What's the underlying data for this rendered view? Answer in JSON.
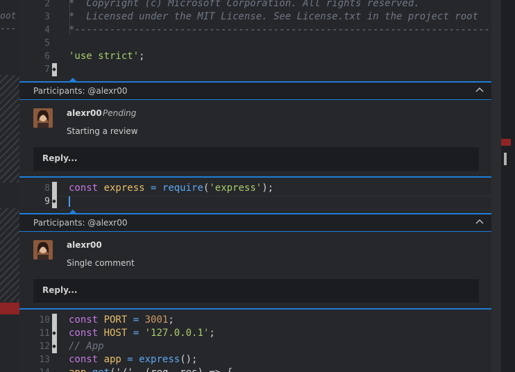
{
  "left_fragments": [
    "oot",
    "---"
  ],
  "code_top": [
    {
      "num": "2",
      "parts": [
        {
          "t": "*  Copyright (c) Microsoft Corporation. All rights reserved.",
          "c": "cm"
        }
      ]
    },
    {
      "num": "3",
      "parts": [
        {
          "t": "*  Licensed under the MIT License. See License.txt in the project root",
          "c": "cm"
        }
      ]
    },
    {
      "num": "4",
      "parts": [
        {
          "t": "*--------------------------------------------------------------------------------",
          "c": "cm"
        }
      ]
    },
    {
      "num": "5",
      "parts": []
    },
    {
      "num": "6",
      "parts": [
        {
          "t": "'use strict'",
          "c": "str"
        },
        {
          "t": ";",
          "c": ""
        }
      ]
    },
    {
      "num": "7",
      "parts": [],
      "mark": true
    }
  ],
  "thread1": {
    "participants": "Participants: @alexr00",
    "author": "alexr00",
    "status": "Pending",
    "body": "Starting a review",
    "reply": "Reply..."
  },
  "code_mid": [
    {
      "num": "8",
      "parts": [
        {
          "t": "const ",
          "c": "kw"
        },
        {
          "t": "express",
          "c": "var"
        },
        {
          "t": " = ",
          "c": "op"
        },
        {
          "t": "require",
          "c": "fn"
        },
        {
          "t": "(",
          "c": ""
        },
        {
          "t": "'express'",
          "c": "str"
        },
        {
          "t": ");",
          "c": ""
        }
      ],
      "mark": true,
      "nodiamond": true
    },
    {
      "num": "9",
      "parts": [],
      "mark": true,
      "active": true,
      "cursor": true
    }
  ],
  "thread2": {
    "participants": "Participants: @alexr00",
    "author": "alexr00",
    "body": "Single comment",
    "reply": "Reply..."
  },
  "code_bottom": [
    {
      "num": "10",
      "parts": [
        {
          "t": "const ",
          "c": "kw"
        },
        {
          "t": "PORT",
          "c": "var"
        },
        {
          "t": " = ",
          "c": "op"
        },
        {
          "t": "3001",
          "c": "num"
        },
        {
          "t": ";",
          "c": ""
        }
      ],
      "mark": true,
      "nodiamond": true
    },
    {
      "num": "11",
      "parts": [
        {
          "t": "const ",
          "c": "kw"
        },
        {
          "t": "HOST",
          "c": "var"
        },
        {
          "t": " = ",
          "c": "op"
        },
        {
          "t": "'127.0.0.1'",
          "c": "str"
        },
        {
          "t": ";",
          "c": ""
        }
      ],
      "mark": true
    },
    {
      "num": "12",
      "parts": [
        {
          "t": "// App",
          "c": "cm"
        }
      ],
      "mark": true
    },
    {
      "num": "13",
      "parts": [
        {
          "t": "const ",
          "c": "kw"
        },
        {
          "t": "app",
          "c": "var"
        },
        {
          "t": " = ",
          "c": "op"
        },
        {
          "t": "express",
          "c": "fn"
        },
        {
          "t": "();",
          "c": ""
        }
      ]
    },
    {
      "num": "14",
      "parts": [
        {
          "t": "app",
          "c": "var"
        },
        {
          "t": ".",
          "c": ""
        },
        {
          "t": "get",
          "c": "fn"
        },
        {
          "t": "('/', (req, res) => {",
          "c": ""
        }
      ]
    }
  ],
  "colors": {
    "accent": "#1f7dd8",
    "error": "#8e2424"
  }
}
